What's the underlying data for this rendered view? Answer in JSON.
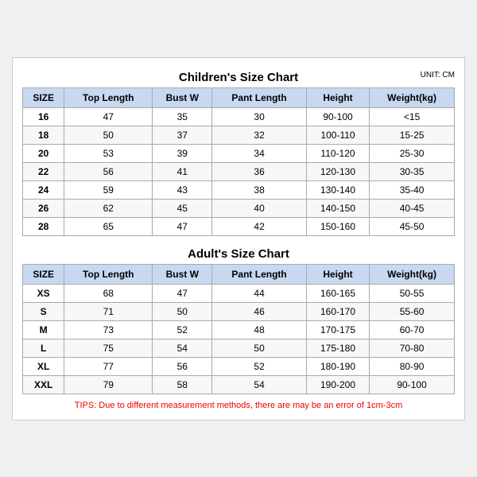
{
  "children_title": "Children's Size Chart",
  "adult_title": "Adult's Size Chart",
  "unit": "UNIT: CM",
  "headers": [
    "SIZE",
    "Top Length",
    "Bust W",
    "Pant Length",
    "Height",
    "Weight(kg)"
  ],
  "children_rows": [
    [
      "16",
      "47",
      "35",
      "30",
      "90-100",
      "<15"
    ],
    [
      "18",
      "50",
      "37",
      "32",
      "100-110",
      "15-25"
    ],
    [
      "20",
      "53",
      "39",
      "34",
      "110-120",
      "25-30"
    ],
    [
      "22",
      "56",
      "41",
      "36",
      "120-130",
      "30-35"
    ],
    [
      "24",
      "59",
      "43",
      "38",
      "130-140",
      "35-40"
    ],
    [
      "26",
      "62",
      "45",
      "40",
      "140-150",
      "40-45"
    ],
    [
      "28",
      "65",
      "47",
      "42",
      "150-160",
      "45-50"
    ]
  ],
  "adult_rows": [
    [
      "XS",
      "68",
      "47",
      "44",
      "160-165",
      "50-55"
    ],
    [
      "S",
      "71",
      "50",
      "46",
      "160-170",
      "55-60"
    ],
    [
      "M",
      "73",
      "52",
      "48",
      "170-175",
      "60-70"
    ],
    [
      "L",
      "75",
      "54",
      "50",
      "175-180",
      "70-80"
    ],
    [
      "XL",
      "77",
      "56",
      "52",
      "180-190",
      "80-90"
    ],
    [
      "XXL",
      "79",
      "58",
      "54",
      "190-200",
      "90-100"
    ]
  ],
  "tips": "TIPS: Due to different measurement methods, there are may be an error of 1cm-3cm"
}
